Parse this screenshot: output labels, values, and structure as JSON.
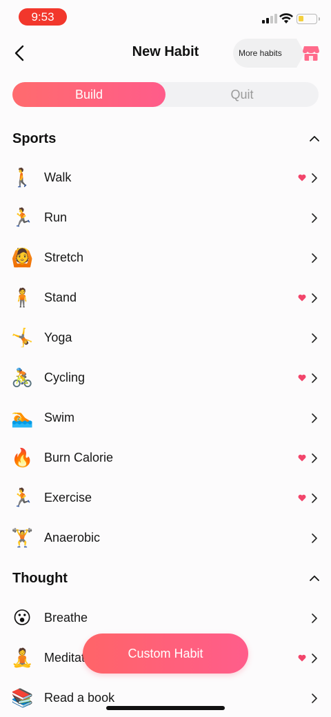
{
  "status": {
    "time": "9:53"
  },
  "nav": {
    "title": "New Habit",
    "more_habits_label": "More habits"
  },
  "segment": {
    "build_label": "Build",
    "quit_label": "Quit",
    "selected": "Build"
  },
  "sections": [
    {
      "title": "Sports",
      "items": [
        {
          "label": "Walk",
          "icon": "walking-person-emoji",
          "glyph": "🚶",
          "favorite": true
        },
        {
          "label": "Run",
          "icon": "running-person-emoji",
          "glyph": "🏃",
          "favorite": false
        },
        {
          "label": "Stretch",
          "icon": "person-stretching-emoji",
          "glyph": "🙆",
          "favorite": false
        },
        {
          "label": "Stand",
          "icon": "standing-person-emoji",
          "glyph": "🧍",
          "favorite": true
        },
        {
          "label": "Yoga",
          "icon": "cartwheel-person-emoji",
          "glyph": "🤸",
          "favorite": false
        },
        {
          "label": "Cycling",
          "icon": "cyclist-emoji",
          "glyph": "🚴",
          "favorite": true
        },
        {
          "label": "Swim",
          "icon": "swimmer-emoji",
          "glyph": "🏊",
          "favorite": false
        },
        {
          "label": "Burn Calorie",
          "icon": "fire-emoji",
          "glyph": "🔥",
          "favorite": true
        },
        {
          "label": "Exercise",
          "icon": "running-person-emoji",
          "glyph": "🏃",
          "favorite": true
        },
        {
          "label": "Anaerobic",
          "icon": "weightlifter-emoji",
          "glyph": "🏋",
          "favorite": false
        }
      ]
    },
    {
      "title": "Thought",
      "items": [
        {
          "label": "Breathe",
          "icon": "exhaling-face-emoji",
          "glyph": "😮",
          "favorite": false
        },
        {
          "label": "Meditate",
          "icon": "person-lotus-position-emoji",
          "glyph": "🧘",
          "favorite": true
        },
        {
          "label": "Read a book",
          "icon": "books-emoji",
          "glyph": "📚",
          "favorite": false
        }
      ]
    }
  ],
  "custom_button_label": "Custom Habit",
  "colors": {
    "accent": "#ff6079",
    "heart": "#f2456b",
    "time_pill": "#f2372c"
  }
}
